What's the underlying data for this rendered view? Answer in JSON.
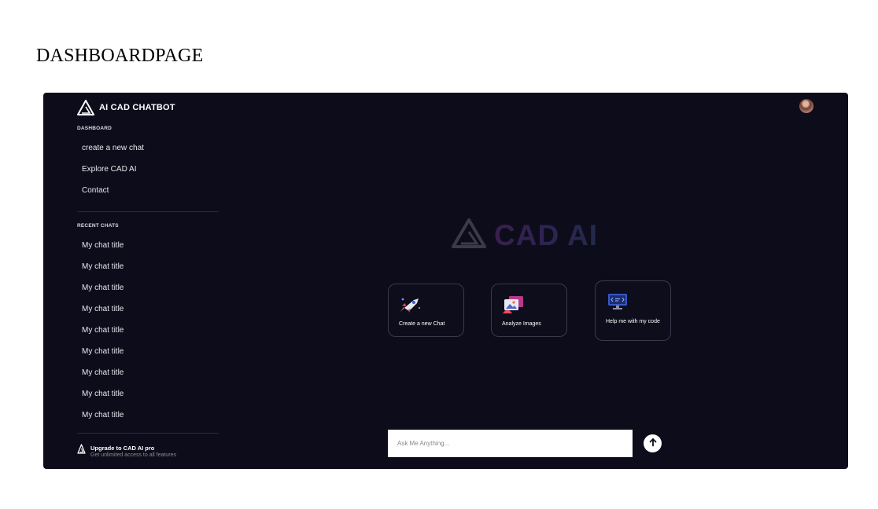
{
  "page": {
    "heading": "DASHBOARDPAGE"
  },
  "sidebar": {
    "brand": "AI CAD CHATBOT",
    "dashboard_label": "DASHBOARD",
    "nav": [
      {
        "label": "create a new chat"
      },
      {
        "label": "Explore CAD AI"
      },
      {
        "label": "Contact"
      }
    ],
    "recent_label": "RECENT CHATS",
    "recent": [
      {
        "label": "My chat title"
      },
      {
        "label": "My chat title"
      },
      {
        "label": "My chat title"
      },
      {
        "label": "My chat title"
      },
      {
        "label": "My chat title"
      },
      {
        "label": "My chat title"
      },
      {
        "label": "My chat title"
      },
      {
        "label": "My chat title"
      },
      {
        "label": "My chat title"
      }
    ],
    "upgrade": {
      "title": "Upgrade to CAD AI pro",
      "subtitle": "Get unlimited access to all features"
    }
  },
  "main": {
    "hero_text": "CAD AI",
    "cards": [
      {
        "label": "Create a new Chat",
        "icon": "rocket-icon"
      },
      {
        "label": "Analyze Images",
        "icon": "image-gallery-icon"
      },
      {
        "label": "Help me with my code",
        "icon": "code-monitor-icon"
      }
    ],
    "input": {
      "placeholder": "Ask Me Anything...",
      "value": ""
    },
    "send_icon": "arrow-up-icon"
  },
  "colors": {
    "app_background": "#0d0c1a",
    "card_border": "#3b3a4a",
    "hero_gradient_start": "#3a1f4e",
    "hero_gradient_end": "#222a4c"
  }
}
